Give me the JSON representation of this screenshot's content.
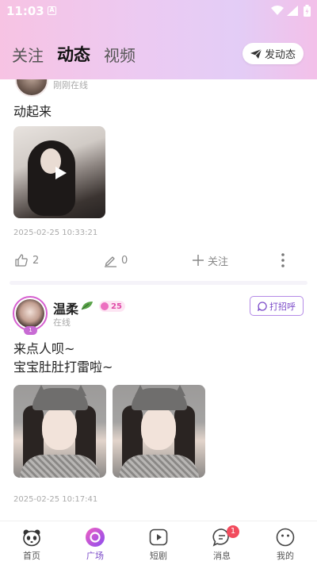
{
  "status_bar": {
    "time": "11:03",
    "a_icon": "A"
  },
  "header": {
    "tabs": [
      {
        "label": "关注"
      },
      {
        "label": "动态"
      },
      {
        "label": "视频"
      }
    ],
    "active_tab": "动态",
    "post_button_label": "发动态",
    "gradient_colors": [
      "#f7c3e3",
      "#e3cdf6"
    ]
  },
  "posts": [
    {
      "status": "刚刚在线",
      "text": "动起来",
      "media": "video",
      "timestamp": "2025-02-25 10:33:21",
      "likes": "2",
      "comments": "0",
      "follow_label": "关注"
    },
    {
      "name": "温柔",
      "badge": "25",
      "avatar_level": "1",
      "status": "在线",
      "greet_label": "打招呼",
      "text_line1": "来点人呗~",
      "text_line2": "宝宝肚肚打雷啦~",
      "media": "photos",
      "timestamp": "2025-02-25 10:17:41"
    }
  ],
  "bottom_nav": [
    {
      "label": "首页",
      "icon": "panda-icon"
    },
    {
      "label": "广场",
      "icon": "plaza-icon"
    },
    {
      "label": "短剧",
      "icon": "play-icon"
    },
    {
      "label": "消息",
      "icon": "message-icon",
      "badge": "1"
    },
    {
      "label": "我的",
      "icon": "smile-icon"
    }
  ],
  "active_nav": "广场",
  "colors": {
    "accent": "#7a49c8",
    "badge_red": "#f24b5d",
    "pink": "#e04ba8"
  }
}
